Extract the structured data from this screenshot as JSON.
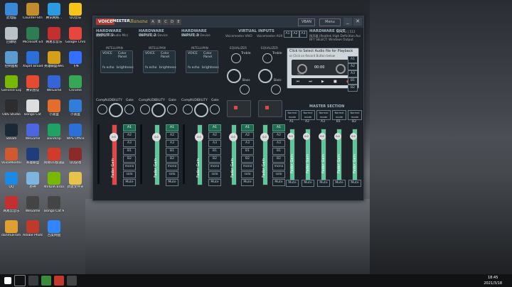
{
  "desktop": {
    "icons": [
      {
        "label": "此电脑",
        "color": "#3a88d8",
        "col": 0,
        "row": 0
      },
      {
        "label": "回收站",
        "color": "#b9c1c9",
        "col": 0,
        "row": 1
      },
      {
        "label": "控制面板",
        "color": "#5c9ad2",
        "col": 0,
        "row": 2
      },
      {
        "label": "GeForce Experience",
        "color": "#76b900",
        "col": 0,
        "row": 3
      },
      {
        "label": "OBS Studio",
        "color": "#2d2d2d",
        "col": 0,
        "row": 4
      },
      {
        "label": "Steam",
        "color": "#1b2838",
        "col": 0,
        "row": 5
      },
      {
        "label": "VoiceMeeter",
        "color": "#d05a2e",
        "col": 0,
        "row": 6
      },
      {
        "label": "QQ",
        "color": "#1e88e5",
        "col": 0,
        "row": 7
      },
      {
        "label": "网易云音乐",
        "color": "#c62f2f",
        "col": 0,
        "row": 8
      },
      {
        "label": "danmuFrom...",
        "color": "#e0a030",
        "col": 0,
        "row": 9
      },
      {
        "label": "Counter-Strike Global Off...",
        "color": "#c28d2c",
        "col": 1,
        "row": 0
      },
      {
        "label": "Microsoft Edge",
        "color": "#2e7d52",
        "col": 1,
        "row": 1
      },
      {
        "label": "XSplit Broadcaster",
        "color": "#2b6fd8",
        "col": 1,
        "row": 2
      },
      {
        "label": "腾讯会议",
        "color": "#e84a2f",
        "col": 1,
        "row": 3
      },
      {
        "label": "Bongo Cat",
        "color": "#dddddd",
        "col": 1,
        "row": 4
      },
      {
        "label": "WeGame",
        "color": "#4a66e0",
        "col": 1,
        "row": 5
      },
      {
        "label": "英雄联盟",
        "color": "#1e3d7a",
        "col": 1,
        "row": 6
      },
      {
        "label": "原神",
        "color": "#7bb5e0",
        "col": 1,
        "row": 7
      },
      {
        "label": "WeGame",
        "color": "#444",
        "col": 1,
        "row": 8
      },
      {
        "label": "Adobe Photoshop",
        "color": "#c0392b",
        "col": 1,
        "row": 9
      },
      {
        "label": "腾讯网络...",
        "color": "#2a9be0",
        "col": 2,
        "row": 0
      },
      {
        "label": "网易云音乐",
        "color": "#c62f2f",
        "col": 2,
        "row": 1
      },
      {
        "label": "英雄联盟WeGame",
        "color": "#d4a017",
        "col": 2,
        "row": 2
      },
      {
        "label": "WeGame",
        "color": "#3465d6",
        "col": 2,
        "row": 3
      },
      {
        "label": "小黑盒",
        "color": "#e56d2b",
        "col": 2,
        "row": 4
      },
      {
        "label": "Bandizip",
        "color": "#1ea362",
        "col": 2,
        "row": 5
      },
      {
        "label": "网易UU加速器",
        "color": "#d23a2a",
        "col": 2,
        "row": 6
      },
      {
        "label": "NVIDIA Broadcast",
        "color": "#76b900",
        "col": 2,
        "row": 7
      },
      {
        "label": "Bongo Cat Mver.exe",
        "color": "#444",
        "col": 2,
        "row": 8
      },
      {
        "label": "百度网盘",
        "color": "#2f86ff",
        "col": 2,
        "row": 9
      },
      {
        "label": "QQ音乐",
        "color": "#f5c518",
        "col": 3,
        "row": 0
      },
      {
        "label": "Google Chrome",
        "color": "#e8453c",
        "col": 3,
        "row": 1
      },
      {
        "label": "飞书",
        "color": "#3370ff",
        "col": 3,
        "row": 2
      },
      {
        "label": "Chrome",
        "color": "#34a853",
        "col": 3,
        "row": 3
      },
      {
        "label": "小黑盒",
        "color": "#2f7edc",
        "col": 3,
        "row": 4
      },
      {
        "label": "WPS Office",
        "color": "#2b6fd8",
        "col": 3,
        "row": 5
      },
      {
        "label": "QQ游戏",
        "color": "#8c2a2a",
        "col": 3,
        "row": 6
      },
      {
        "label": "新建文件夹",
        "color": "#e7c34a",
        "col": 3,
        "row": 7
      }
    ]
  },
  "window": {
    "logo_voice": "VOICE",
    "logo_meeter": "MEETER",
    "logo_banana": "Banana",
    "abc": [
      "A",
      "B",
      "C",
      "D",
      "E"
    ],
    "vban": "VBAN",
    "menu": "Menu",
    "minimize": "_",
    "close": "✕"
  },
  "hardware_inputs": [
    {
      "title": "HARDWARE INPUT 1",
      "sub": "麦克风 (HD Audio Mic)",
      "intel": "INTELLIPAN",
      "voice": "VOICE",
      "color_panel": "Color Panel",
      "fx_left": "fx echo",
      "fx_right": "brightness",
      "comp": "Comp",
      "aud": "AUDIBILITY",
      "gate": "Gate",
      "fader_label": "Fader Gain",
      "fader_value": "0.0",
      "fader_color": "#e04848"
    },
    {
      "title": "HARDWARE INPUT 2",
      "sub": "Select Input Device",
      "intel": "INTELLIPAN",
      "voice": "VOICE",
      "color_panel": "Color Panel",
      "fx_left": "fx echo",
      "fx_right": "brightness",
      "comp": "Comp",
      "aud": "AUDIBILITY",
      "gate": "Gate",
      "fader_label": "Fader Gain",
      "fader_value": "0.0",
      "fader_color": "#5fc59a"
    },
    {
      "title": "HARDWARE INPUT 3",
      "sub": "Select Input Device",
      "intel": "INTELLIPAN",
      "voice": "VOICE",
      "color_panel": "Color Panel",
      "fx_left": "fx echo",
      "fx_right": "brightness",
      "comp": "Comp",
      "aud": "AUDIBILITY",
      "gate": "Gate",
      "fader_label": "Fader Gain",
      "fader_value": "0.0",
      "fader_color": "#5fc59a"
    }
  ],
  "routing_labels": [
    "A1",
    "A2",
    "A3",
    "B1",
    "B2",
    "mono",
    "solo",
    "Mute"
  ],
  "virtual_inputs": {
    "title": "VIRTUAL INPUTS",
    "strips": [
      {
        "name": "Voicemeeter VAIO",
        "eq": "EQUALIZER",
        "treble": "Treble",
        "bass": "Bass",
        "fader_label": "Fader Gain",
        "fader_value": "0.0"
      },
      {
        "name": "Voicemeeter AUX",
        "eq": "EQUALIZER",
        "treble": "Treble",
        "bass": "Bass",
        "fader_label": "Fader Gain",
        "fader_value": "0.0"
      }
    ]
  },
  "hardware_out": {
    "title": "HARDWARE OUT",
    "rate": "48 kHz | 512",
    "outs": [
      "A1",
      "A2",
      "A3"
    ],
    "a1_device": "扬声器 (Realtek High Definition Audio)",
    "a2_device": "BFT SELECT: Windows Output"
  },
  "tape": {
    "header": "Click to Select Audio file for Playback",
    "sub": "or Click on Record Button below",
    "time": "00:00",
    "input_label": "input",
    "out_labels": [
      "A1",
      "A2",
      "A3",
      "B1",
      "B2"
    ]
  },
  "master": {
    "title": "MASTER SECTION",
    "buses": [
      "A1",
      "A2",
      "A3",
      "B1",
      "B2"
    ],
    "mode": "Normal mode",
    "fader_label": "Fader Gain",
    "fader_value": "0.0",
    "mute": "Mute"
  },
  "taskbar": {
    "time": "18:45",
    "date": "2021/3/18"
  }
}
